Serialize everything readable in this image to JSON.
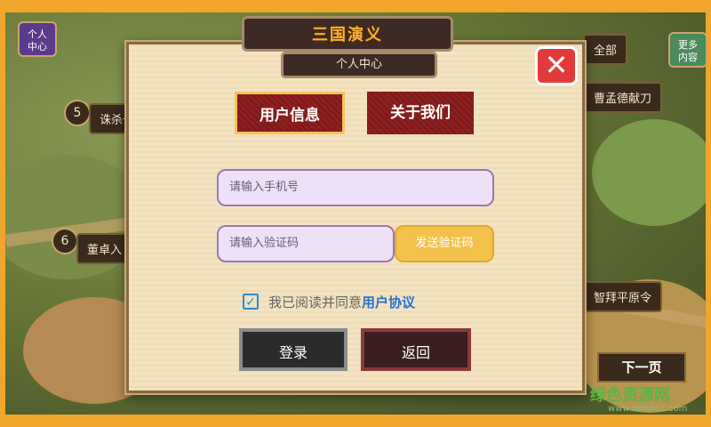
{
  "header": {
    "logo_text": "三国演义",
    "subtitle": "个人中心"
  },
  "dialog": {
    "tabs": [
      {
        "label": "用户信息",
        "active": true
      },
      {
        "label": "关于我们",
        "active": false
      }
    ],
    "phone_placeholder": "请输入手机号",
    "code_placeholder": "请输入验证码",
    "send_code_label": "发送验证码",
    "agreement": {
      "checked": true,
      "prefix": "我已阅读并同意",
      "link": "用户协议"
    },
    "login_label": "登录",
    "back_label": "返回",
    "close_symbol": "✕"
  },
  "map": {
    "left_button": "个人\n中心",
    "right_button": "更多\n内容",
    "labels": [
      {
        "num": "5",
        "text": "诛杀十"
      },
      {
        "num": "6",
        "text": "董卓入"
      },
      {
        "text": "全部"
      },
      {
        "text": "曹孟德献刀"
      },
      {
        "text": "智拜平原令"
      }
    ],
    "next_page": "下一页"
  },
  "watermark": {
    "brand": "绿色资源网",
    "url": "www.downcc.com"
  },
  "colors": {
    "frame": "#f0a62a",
    "tab_red": "#8f1f1f",
    "send_yellow": "#f3c24a",
    "link_blue": "#2a6fd0",
    "close_red": "#e23a3a"
  }
}
